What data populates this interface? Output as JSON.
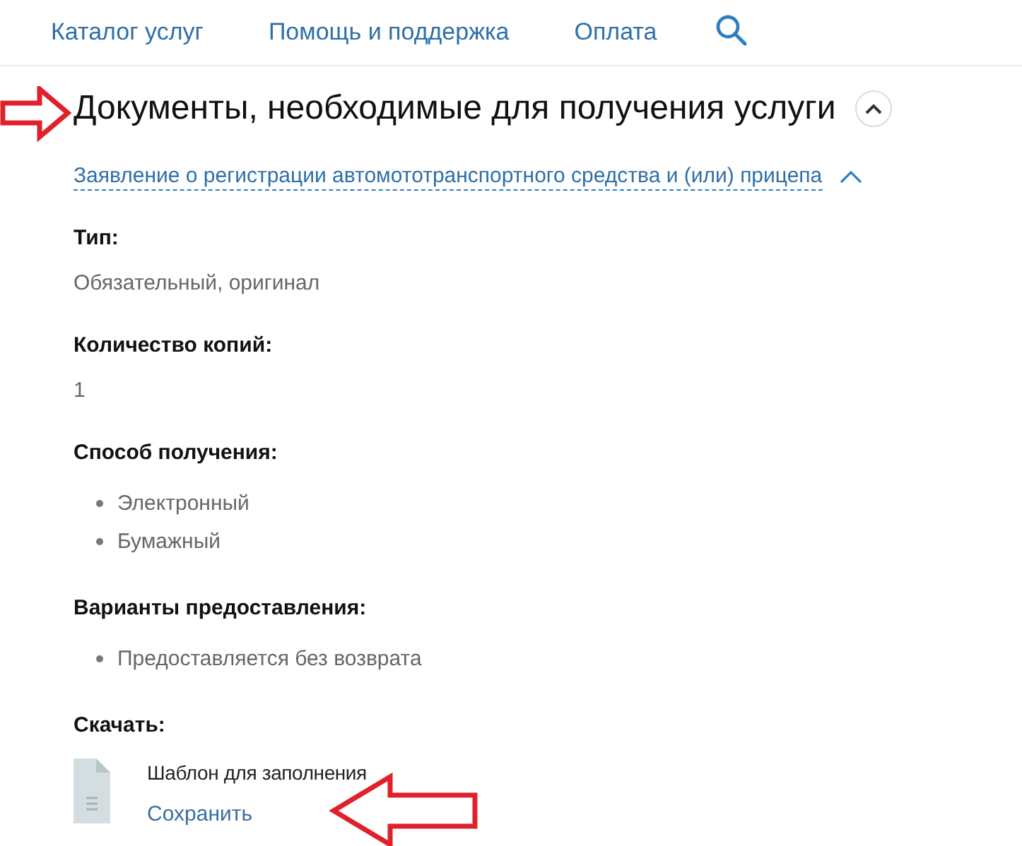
{
  "nav": [
    {
      "label": "Каталог услуг"
    },
    {
      "label": "Помощь и поддержка"
    },
    {
      "label": "Оплата"
    }
  ],
  "section": {
    "title": "Документы, необходимые для получения услуги",
    "expanded": true
  },
  "document": {
    "title": "Заявление о регистрации автомототранспортного средства и (или) прицепа",
    "expanded": true,
    "fields": [
      {
        "kind": "text",
        "label": "Тип:",
        "value": "Обязательный, оригинал"
      },
      {
        "kind": "text",
        "label": "Количество копий:",
        "value": "1"
      },
      {
        "kind": "list",
        "label": "Способ получения:",
        "items": [
          "Электронный",
          "Бумажный"
        ]
      },
      {
        "kind": "list",
        "label": "Варианты предоставления:",
        "items": [
          "Предоставляется без возврата"
        ]
      },
      {
        "kind": "file",
        "label": "Скачать:",
        "file_name": "Шаблон для заполнения",
        "action": "Сохранить"
      }
    ]
  }
}
